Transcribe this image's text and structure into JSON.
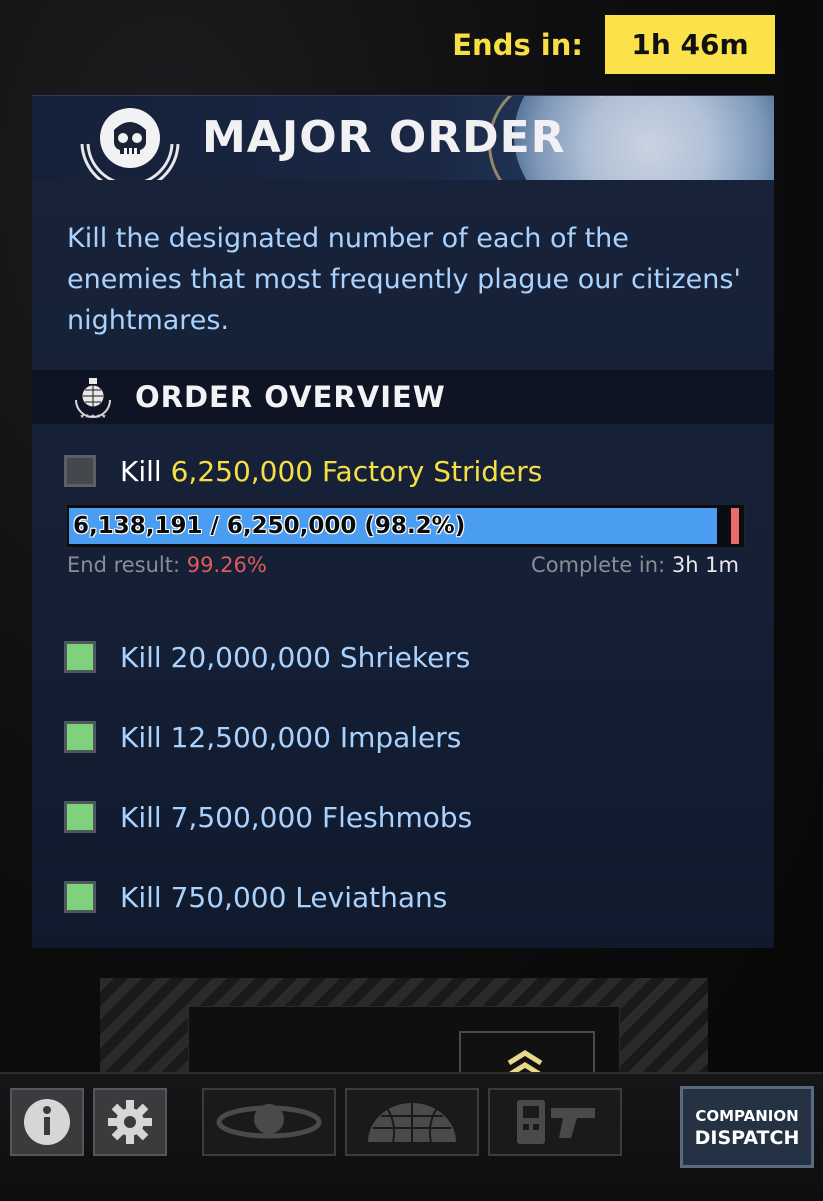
{
  "ends": {
    "label": "Ends in:",
    "value": "1h 46m"
  },
  "major_order": {
    "title": "MAJOR ORDER",
    "description": "Kill the designated number of each of the enemies that most frequently plague our citizens' nightmares.",
    "overview_title": "ORDER OVERVIEW"
  },
  "tasks": [
    {
      "verb": "Kill",
      "target": "6,250,000 Factory Striders",
      "complete": false
    },
    {
      "text": "Kill 20,000,000 Shriekers",
      "complete": true
    },
    {
      "text": "Kill 12,500,000 Impalers",
      "complete": true
    },
    {
      "text": "Kill 7,500,000 Fleshmobs",
      "complete": true
    },
    {
      "text": "Kill 750,000 Leviathans",
      "complete": true
    }
  ],
  "progress": {
    "label": "6,138,191 / 6,250,000 (98.2%)",
    "fraction": 0.982,
    "end_result_label": "End result:",
    "end_result_value": "99.26%",
    "complete_in_label": "Complete in:",
    "complete_in_value": "3h 1m"
  },
  "bottom_bar": {
    "companion_line1": "COMPANION",
    "companion_line2": "DISPATCH",
    "icons": [
      "info-icon",
      "gear-icon",
      "galaxy-icon",
      "war-map-globe-icon",
      "loadout-icon"
    ]
  },
  "colors": {
    "accent_yellow": "#fbe24a",
    "text_blue": "#a9d2ff",
    "progress_blue": "#4a9df1",
    "complete_green": "#7fd27d",
    "danger_red": "#e25a5a"
  }
}
